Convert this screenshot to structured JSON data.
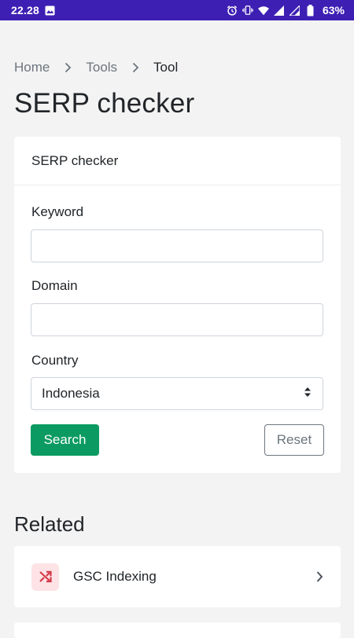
{
  "status_bar": {
    "time": "22.28",
    "battery": "63%"
  },
  "breadcrumb": {
    "items": [
      "Home",
      "Tools",
      "Tool"
    ]
  },
  "page": {
    "title": "SERP checker"
  },
  "form_card": {
    "header": "SERP checker",
    "keyword_label": "Keyword",
    "keyword_value": "",
    "domain_label": "Domain",
    "domain_value": "",
    "country_label": "Country",
    "country_selected": "Indonesia",
    "search_button": "Search",
    "reset_button": "Reset"
  },
  "related": {
    "title": "Related",
    "items": [
      {
        "label": "GSC Indexing",
        "icon": "shuffle-icon"
      }
    ]
  },
  "colors": {
    "status_bar": "#3d1fb3",
    "primary_button": "#0b9b62",
    "related_icon_bg": "#fde3e5",
    "related_icon_fg": "#d63a4a",
    "page_bg": "#f3f3f3"
  }
}
